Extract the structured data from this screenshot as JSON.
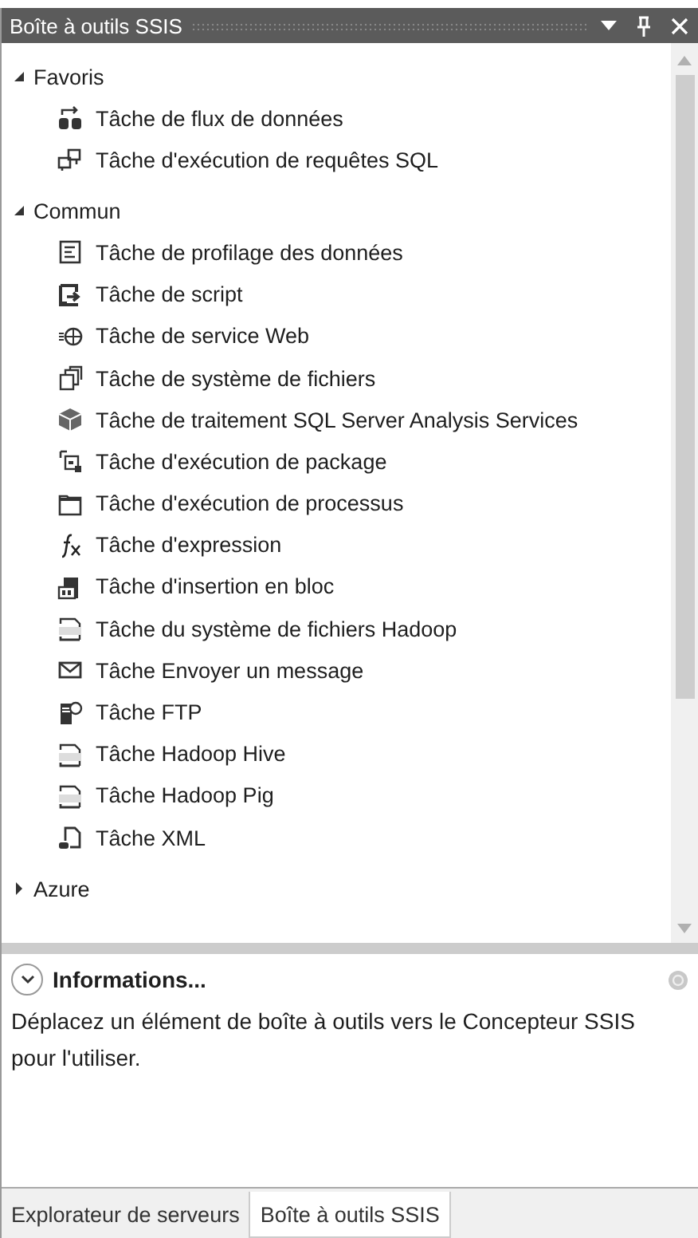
{
  "window": {
    "title": "Boîte à outils SSIS"
  },
  "toolbox": {
    "groups": [
      {
        "label": "Favoris",
        "expanded": true,
        "children": [
          {
            "label": "Tâche de flux de données",
            "kind": "dataflow"
          },
          {
            "label": "Tâche d'exécution de requêtes SQL",
            "kind": "sql"
          }
        ]
      },
      {
        "label": "Commun",
        "expanded": true,
        "children": [
          {
            "label": "Tâche de profilage des données",
            "kind": "profile"
          },
          {
            "label": "Tâche de script",
            "kind": "script"
          },
          {
            "label": "Tâche de service Web",
            "kind": "web"
          },
          {
            "label": "Tâche de système de fichiers",
            "kind": "files"
          },
          {
            "label": "Tâche de traitement SQL Server Analysis Services",
            "kind": "cube"
          },
          {
            "label": "Tâche d'exécution de package",
            "kind": "package"
          },
          {
            "label": "Tâche d'exécution de processus",
            "kind": "process"
          },
          {
            "label": "Tâche d'expression",
            "kind": "expression"
          },
          {
            "label": "Tâche d'insertion en bloc",
            "kind": "bulk"
          },
          {
            "label": "Tâche du système de fichiers Hadoop",
            "kind": "hdfs"
          },
          {
            "label": "Tâche Envoyer un message",
            "kind": "mail"
          },
          {
            "label": "Tâche FTP",
            "kind": "ftp"
          },
          {
            "label": "Tâche Hadoop Hive",
            "kind": "hive"
          },
          {
            "label": "Tâche Hadoop Pig",
            "kind": "pig"
          },
          {
            "label": "Tâche XML",
            "kind": "xml"
          }
        ]
      },
      {
        "label": "Azure",
        "expanded": false
      }
    ]
  },
  "info": {
    "title": "Informations...",
    "text": "Déplacez un élément de boîte à outils vers le Concepteur SSIS pour l'utiliser."
  },
  "tabs": [
    {
      "label": "Explorateur de serveurs",
      "selected": false
    },
    {
      "label": "Boîte à outils SSIS",
      "selected": true
    }
  ]
}
